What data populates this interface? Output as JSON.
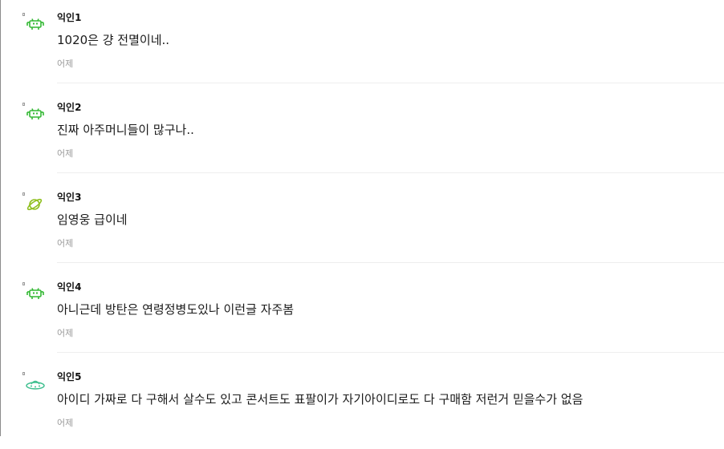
{
  "comments": [
    {
      "author": "익인1",
      "text": "1020은 걍 전멸이네..",
      "time": "어제",
      "avatar_icon": "space-invader-icon",
      "avatar_color": "#33b833"
    },
    {
      "author": "익인2",
      "text": "진짜 아주머니들이 많구나..",
      "time": "어제",
      "avatar_icon": "space-invader-icon",
      "avatar_color": "#33b833"
    },
    {
      "author": "익인3",
      "text": "임영웅 급이네",
      "time": "어제",
      "avatar_icon": "planet-icon",
      "avatar_color": "#8fbf1f"
    },
    {
      "author": "익인4",
      "text": "아니근데 방탄은 연령정병도있나 이런글 자주봄",
      "time": "어제",
      "avatar_icon": "space-invader-icon",
      "avatar_color": "#33b833"
    },
    {
      "author": "익인5",
      "text": "아이디 가짜로 다 구해서 살수도 있고 콘서트도 표팔이가 자기아이디로도 다 구매함 저런거 믿을수가 없음",
      "time": "어제",
      "avatar_icon": "ufo-icon",
      "avatar_color": "#3fbf8f"
    }
  ]
}
